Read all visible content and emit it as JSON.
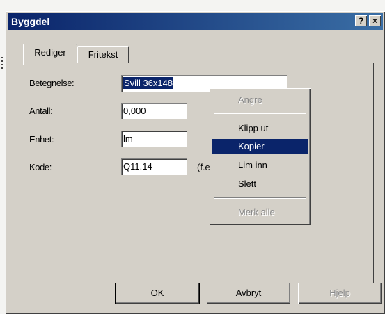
{
  "window": {
    "title": "Byggdel",
    "help_btn": "?",
    "close_btn": "×"
  },
  "tabs": [
    {
      "label": "Rediger",
      "active": true
    },
    {
      "label": "Fritekst",
      "active": false
    }
  ],
  "form": {
    "betegnelse": {
      "label": "Betegnelse:",
      "value": "Svill 36x148"
    },
    "antall": {
      "label": "Antall:",
      "value": "0,000"
    },
    "enhet": {
      "label": "Enhet:",
      "value": "lm"
    },
    "kode": {
      "label": "Kode:",
      "value": "Q11.14",
      "hint": "(f.e"
    }
  },
  "context_menu": {
    "items": [
      {
        "label": "Angre",
        "disabled": true
      },
      {
        "label": "Klipp ut",
        "disabled": false
      },
      {
        "label": "Kopier",
        "disabled": false,
        "highlighted": true
      },
      {
        "label": "Lim inn",
        "disabled": false
      },
      {
        "label": "Slett",
        "disabled": false
      },
      {
        "label": "Merk alle",
        "disabled": true
      }
    ]
  },
  "buttons": {
    "ok": "OK",
    "cancel": "Avbryt",
    "help": "Hjelp"
  },
  "colors": {
    "titlebar_start": "#0a246a",
    "titlebar_end": "#3a6ea5",
    "face": "#d4d0c8",
    "highlight": "#0a246a"
  }
}
